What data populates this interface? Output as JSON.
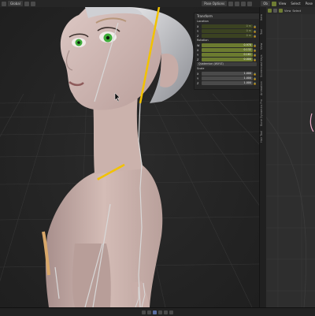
{
  "header": {
    "transform_orientation": "Global",
    "pose_options": "Pose Options",
    "right_menu": [
      "View",
      "Select",
      "Pose"
    ],
    "right_dropdown": "Ob"
  },
  "n_panel": {
    "title": "Transform",
    "location": {
      "label": "Location",
      "fields": [
        {
          "axis": "X",
          "value": "0 m"
        },
        {
          "axis": "Y",
          "value": "0 m"
        },
        {
          "axis": "Z",
          "value": "0 m"
        }
      ]
    },
    "rotation": {
      "label": "Rotation",
      "fields": [
        {
          "axis": "W",
          "value": "0.978"
        },
        {
          "axis": "X",
          "value": "0.132"
        },
        {
          "axis": "Y",
          "value": "0.161"
        },
        {
          "axis": "Z",
          "value": "0.000"
        }
      ],
      "mode": "Quaternion (WXYZ)"
    },
    "scale": {
      "label": "Scale",
      "fields": [
        {
          "axis": "X",
          "value": "1.000"
        },
        {
          "axis": "Y",
          "value": "1.000"
        },
        {
          "axis": "Z",
          "value": "1.000"
        }
      ]
    }
  },
  "side_tabs": [
    "Item",
    "Tool",
    "View",
    "Screencast Keys",
    "Animation",
    "Bone Dynamics Pro",
    "Hair Tool"
  ],
  "colors": {
    "active_field": "#6c7b30",
    "bone_highlight": "#f2c200",
    "skin": "#cfb4ae",
    "iris": "#3fae3a"
  }
}
